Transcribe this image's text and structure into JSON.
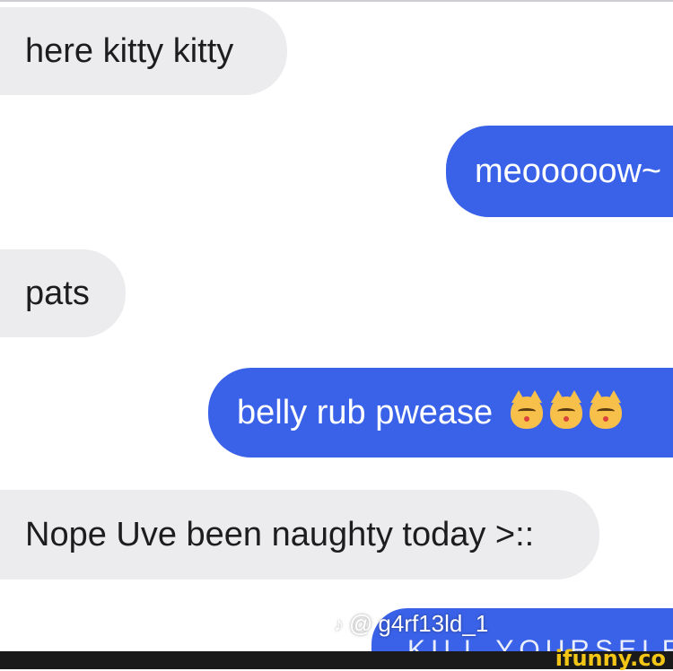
{
  "messages": [
    {
      "side": "incoming",
      "text": "here kitty kitty"
    },
    {
      "side": "outgoing",
      "text": "meooooow~"
    },
    {
      "side": "incoming",
      "text": "pats"
    },
    {
      "side": "outgoing",
      "text": "belly rub pwease",
      "emoji": [
        "kissing-cat-icon",
        "kissing-cat-icon",
        "kissing-cat-icon"
      ]
    },
    {
      "side": "incoming",
      "text": "Nope Uve been naughty today >::"
    },
    {
      "side": "outgoing",
      "text": "KILL YOURSELF"
    }
  ],
  "watermark": {
    "prefix": "@",
    "handle": "g4rf13ld_1"
  },
  "footer": {
    "brand": "ifunny.co"
  },
  "colors": {
    "incoming_bg": "#ececee",
    "outgoing_bg": "#3a62e8",
    "footer_bg": "#1a1a1a",
    "brand": "#f2c516"
  }
}
